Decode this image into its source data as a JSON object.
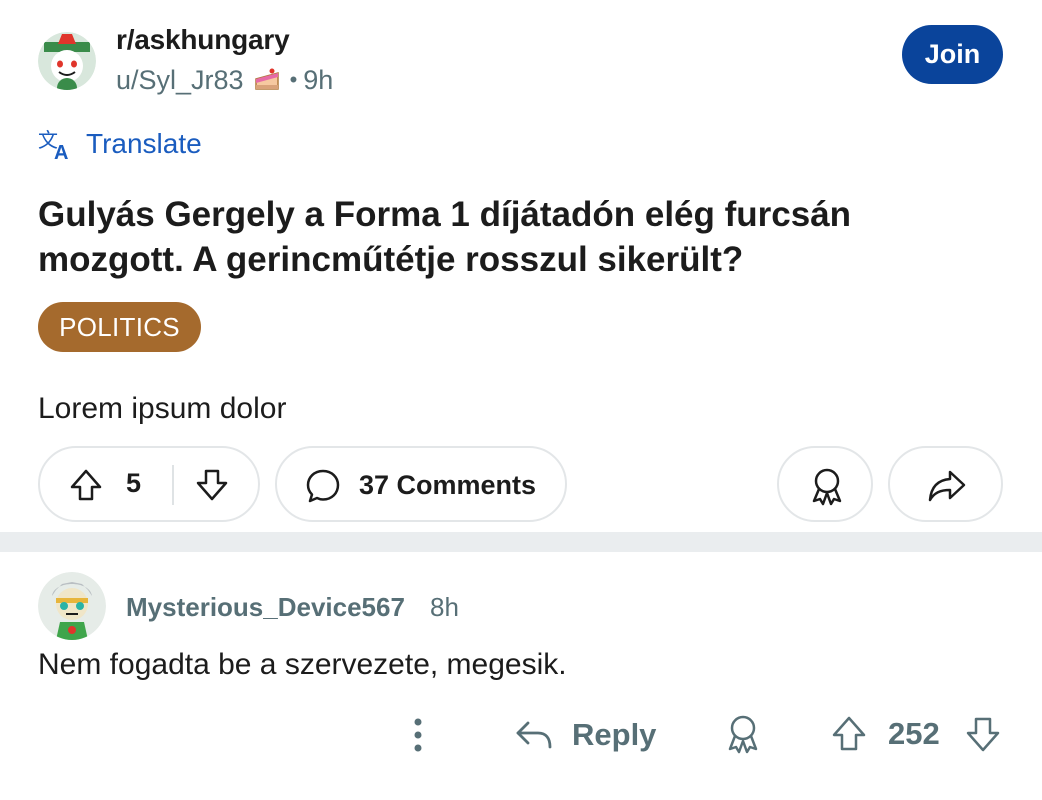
{
  "post": {
    "subreddit": "r/askhungary",
    "author": "u/Syl_Jr83",
    "author_badge_icon": "cake-day-icon",
    "separator": "•",
    "age": "9h",
    "join_label": "Join",
    "translate_label": "Translate",
    "title": "Gulyás Gergely a Forma 1 díjátadón elég furcsán mozgott. A gerincműtétje rosszul sikerült?",
    "flair": "POLITICS",
    "flair_color": "#a56a2d",
    "body": "Lorem ipsum dolor",
    "score": "5",
    "comments_label": "37 Comments"
  },
  "comment": {
    "author": "Mysterious_Device567",
    "age": "8h",
    "text": "Nem fogadta be a szervezete, megesik.",
    "reply_label": "Reply",
    "score": "252"
  },
  "colors": {
    "join_button": "#0a449b",
    "link_blue": "#1a5cbf",
    "muted_text": "#576f76",
    "divider": "#eaedef"
  }
}
